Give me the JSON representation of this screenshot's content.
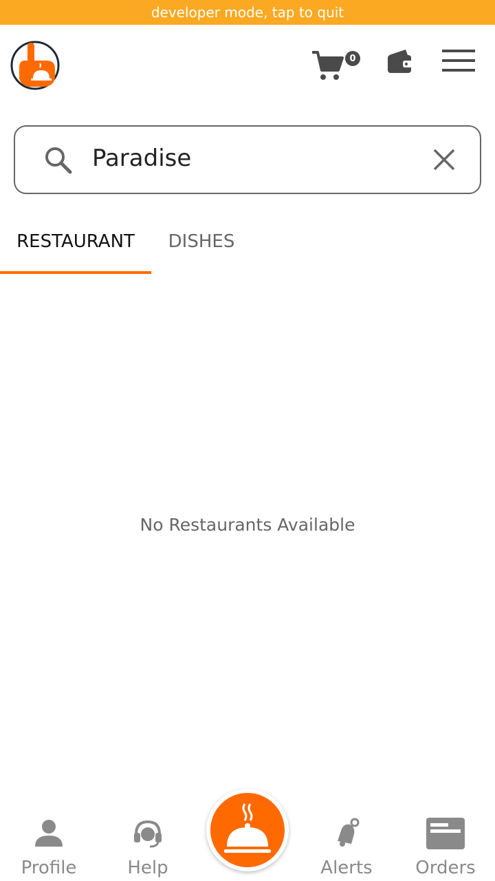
{
  "dev_banner": "developer mode, tap to quit",
  "header": {
    "logo_icon": "hand-cloche-logo-icon",
    "cart_count": "0",
    "cart_icon": "cart-icon",
    "wallet_icon": "wallet-icon",
    "menu_icon": "menu-icon"
  },
  "search": {
    "value": "Paradise",
    "search_icon": "search-icon",
    "clear_icon": "close-icon"
  },
  "tabs": [
    {
      "label": "RESTAURANT",
      "active": true
    },
    {
      "label": "DISHES",
      "active": false
    }
  ],
  "empty_message": "No Restaurants Available",
  "bottom_nav": {
    "items": [
      {
        "label": "Profile",
        "icon": "person-icon"
      },
      {
        "label": "Help",
        "icon": "headset-icon"
      },
      {
        "label": "",
        "icon": "cloche-icon"
      },
      {
        "label": "Alerts",
        "icon": "bell-icon"
      },
      {
        "label": "Orders",
        "icon": "orders-icon"
      }
    ]
  },
  "colors": {
    "accent": "#FF6A00",
    "dev_banner": "#FBA922",
    "icon_gray": "#4a4a4a",
    "nav_gray": "#8a8a8a"
  }
}
